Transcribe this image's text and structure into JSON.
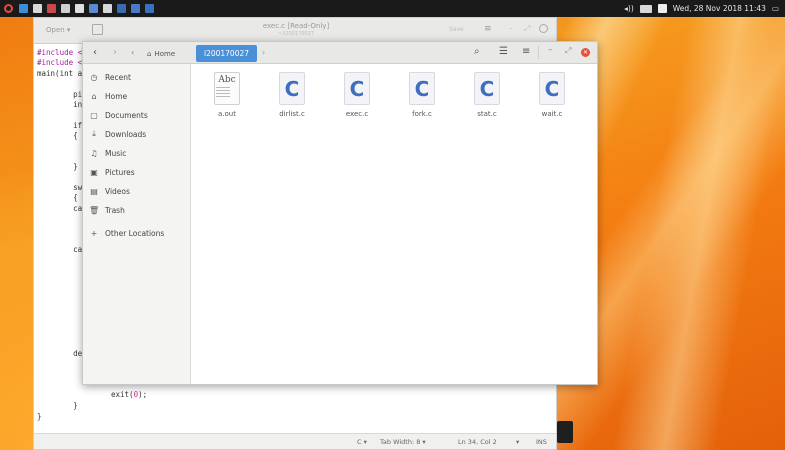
{
  "top_panel": {
    "datetime": "Wed, 28 Nov 2018 11:43",
    "launcher_colors": [
      "#3b8fd8",
      "#d8d8d8",
      "#c84a4a",
      "#d0d0d0",
      "#e0e0e0",
      "#5a8ad0",
      "#d8d8d8",
      "#3a6ab0",
      "#4a7ac8",
      "#3a70c0"
    ]
  },
  "gedit": {
    "open_label": "Open ▾",
    "title": "exec.c [Read-Only]",
    "subtitle": "~/l200170027",
    "save_label": "Save",
    "code_lines": [
      {
        "text": "#include <",
        "cls": "pp"
      },
      {
        "text": "#include <",
        "cls": "pp"
      },
      {
        "text": "main(int a",
        "cls": ""
      },
      {
        "text": "",
        "cls": ""
      },
      {
        "text": "        pi",
        "cls": ""
      },
      {
        "text": "        in",
        "cls": ""
      },
      {
        "text": "",
        "cls": ""
      },
      {
        "text": "        if",
        "cls": ""
      },
      {
        "text": "        {",
        "cls": ""
      },
      {
        "text": "",
        "cls": ""
      },
      {
        "text": "",
        "cls": ""
      },
      {
        "text": "        }",
        "cls": ""
      },
      {
        "text": "",
        "cls": ""
      },
      {
        "text": "        sw",
        "cls": ""
      },
      {
        "text": "        {",
        "cls": ""
      },
      {
        "text": "        ca",
        "cls": ""
      },
      {
        "text": "",
        "cls": ""
      },
      {
        "text": "",
        "cls": ""
      },
      {
        "text": "",
        "cls": ""
      },
      {
        "text": "        ca",
        "cls": ""
      },
      {
        "text": "",
        "cls": ""
      },
      {
        "text": "",
        "cls": ""
      },
      {
        "text": "",
        "cls": ""
      },
      {
        "text": "",
        "cls": ""
      },
      {
        "text": "",
        "cls": ""
      },
      {
        "text": "",
        "cls": ""
      },
      {
        "text": "",
        "cls": ""
      },
      {
        "text": "",
        "cls": ""
      },
      {
        "text": "",
        "cls": ""
      },
      {
        "text": "        de",
        "cls": ""
      },
      {
        "text": "",
        "cls": ""
      },
      {
        "text": "",
        "cls": ""
      },
      {
        "text": "",
        "cls": ""
      },
      {
        "text": "",
        "cls": ""
      },
      {
        "text": "        }",
        "cls": ""
      },
      {
        "text": "}",
        "cls": ""
      }
    ],
    "exit_line_prefix": "exit(",
    "exit_line_num": "0",
    "exit_line_suffix": ");",
    "status": {
      "language": "C ▾",
      "tab_width": "Tab Width: 8 ▾",
      "position": "Ln 34, Col 2",
      "dropdown": "▾",
      "mode": "INS"
    }
  },
  "files": {
    "breadcrumb_home": "Home",
    "breadcrumb_current": "l200170027",
    "sidebar": [
      {
        "label": "Recent",
        "icon": "◷",
        "name": "clock-icon"
      },
      {
        "label": "Home",
        "icon": "⌂",
        "name": "home-icon"
      },
      {
        "label": "Documents",
        "icon": "▢",
        "name": "document-icon"
      },
      {
        "label": "Downloads",
        "icon": "⤓",
        "name": "download-icon"
      },
      {
        "label": "Music",
        "icon": "♫",
        "name": "music-icon"
      },
      {
        "label": "Pictures",
        "icon": "▣",
        "name": "picture-icon"
      },
      {
        "label": "Videos",
        "icon": "▤",
        "name": "video-icon"
      },
      {
        "label": "Trash",
        "icon": "🗑",
        "name": "trash-icon"
      },
      {
        "label": "Other Locations",
        "icon": "+",
        "name": "plus-icon"
      }
    ],
    "items": [
      {
        "name": "a.out",
        "type": "text"
      },
      {
        "name": "dirlist.c",
        "type": "c"
      },
      {
        "name": "exec.c",
        "type": "c"
      },
      {
        "name": "fork.c",
        "type": "c"
      },
      {
        "name": "stat.c",
        "type": "c"
      },
      {
        "name": "wait.c",
        "type": "c"
      }
    ],
    "text_icon_label": "Abc",
    "c_icon_label": "C"
  }
}
